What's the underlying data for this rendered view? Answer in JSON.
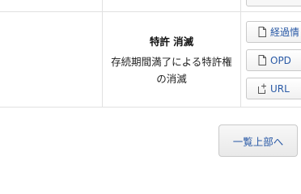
{
  "status": {
    "title": "特許 消滅",
    "description": "存続期間満了による特許権の消滅"
  },
  "actions": [
    {
      "label": "経過情",
      "icon": "document-icon"
    },
    {
      "label": "OPD",
      "icon": "document-icon"
    },
    {
      "label": "URL",
      "icon": "link-add-icon"
    }
  ],
  "back_to_top": {
    "label": "一覧上部へ"
  },
  "colors": {
    "link": "#2a5aa6",
    "border": "#e1e1e1"
  }
}
